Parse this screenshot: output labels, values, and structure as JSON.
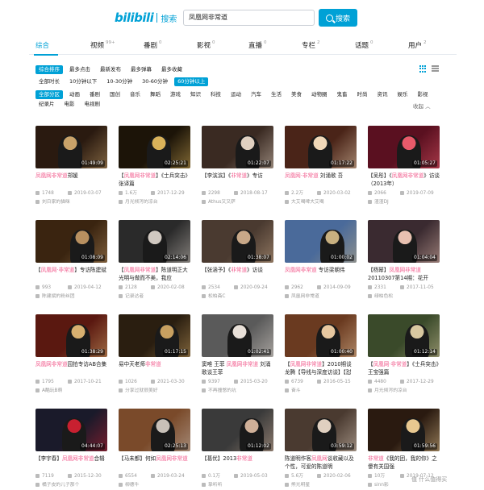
{
  "header": {
    "logo": "bilibili",
    "logo_sub": "搜索",
    "search_value": "凤凰网非常道",
    "search_button": "搜索"
  },
  "tabs": [
    {
      "label": "综合",
      "count": "",
      "active": true
    },
    {
      "label": "视频",
      "count": "99+",
      "active": false
    },
    {
      "label": "番剧",
      "count": "0",
      "active": false
    },
    {
      "label": "影视",
      "count": "0",
      "active": false
    },
    {
      "label": "直播",
      "count": "0",
      "active": false
    },
    {
      "label": "专栏",
      "count": "2",
      "active": false
    },
    {
      "label": "话题",
      "count": "0",
      "active": false
    },
    {
      "label": "用户",
      "count": "2",
      "active": false
    }
  ],
  "filters": {
    "order": [
      "综合排序",
      "最多点击",
      "最新发布",
      "最多弹幕",
      "最多收藏"
    ],
    "duration": [
      "全部时长",
      "10分钟以下",
      "10-30分钟",
      "30-60分钟",
      "60分钟以上"
    ],
    "zones_row1": [
      "全部分区",
      "动画",
      "番剧",
      "国创",
      "音乐",
      "舞蹈",
      "游戏",
      "知识",
      "科技",
      "运动",
      "汽车",
      "生活",
      "美食",
      "动物圈",
      "鬼畜",
      "时尚",
      "资讯",
      "娱乐",
      "影视"
    ],
    "zones_row2": [
      "纪录片",
      "电影",
      "电视剧"
    ],
    "collapse": "收起 ︿"
  },
  "videos": [
    {
      "title_pre": "",
      "title_hl": "凤凰网非常道",
      "title_post": "郑媛",
      "duration": "01:49:09",
      "plays": "1748",
      "date": "2019-03-07",
      "up": "刘日家的猫咪"
    },
    {
      "title_pre": "【",
      "title_hl": "凤凰网非常道",
      "title_post": "】《士兵突击》张译篇",
      "duration": "02:25:21",
      "plays": "1.6万",
      "date": "2017-12-29",
      "up": "月光倾泻的凉台"
    },
    {
      "title_pre": "【李滨滨】《",
      "title_hl": "非常道",
      "title_post": "》专访",
      "duration": "01:22:07",
      "plays": "2298",
      "date": "2018-08-17",
      "up": "Athus又又萨"
    },
    {
      "title_pre": "",
      "title_hl": "凤凰网·非常道",
      "title_post": " 刘涌歌 吾",
      "duration": "01:17:22",
      "plays": "2.2万",
      "date": "2020-03-02",
      "up": "大艾喝啤大艾喝"
    },
    {
      "title_pre": "【吴彤】《",
      "title_hl": "凤凰网非常道",
      "title_post": "》访谈（2013年）",
      "duration": "01:05:27",
      "plays": "2066",
      "date": "2019-07-09",
      "up": "渣渣DJ"
    },
    {
      "title_pre": "【",
      "title_hl": "凤凰网·非常道",
      "title_post": "】专访陈建斌",
      "duration": "01:08:09",
      "plays": "993",
      "date": "2019-04-12",
      "up": "陈建斌的粉丝团"
    },
    {
      "title_pre": "【",
      "title_hl": "凤凰网非常道",
      "title_post": "】陈道明正大光明与做而不美，我应",
      "duration": "02:14:06",
      "plays": "2128",
      "date": "2020-02-08",
      "up": "记录达者"
    },
    {
      "title_pre": "【张涵予】《",
      "title_hl": "非常道",
      "title_post": "》访谈",
      "duration": "01:38:07",
      "plays": "2534",
      "date": "2020-09-24",
      "up": "松柏斋C"
    },
    {
      "title_pre": "",
      "title_hl": "凤凰网非常道",
      "title_post": " 专访梁朝伟",
      "duration": "01:00:02",
      "plays": "2962",
      "date": "2014-09-09",
      "up": "凤凰网非常道"
    },
    {
      "title_pre": "【杨幂】",
      "title_hl": "凤凰网非常道",
      "title_post": "20110307第14期：花开",
      "duration": "01:04:04",
      "plays": "2331",
      "date": "2017-11-05",
      "up": "绿柏色松"
    },
    {
      "title_pre": "",
      "title_hl": "凤凰网非常道",
      "title_post": "园拍专访AB合集",
      "duration": "01:38:29",
      "plays": "1795",
      "date": "2017-10-21",
      "up": "A酷玩B萌"
    },
    {
      "title_pre": "易中天老师",
      "title_hl": "非常道",
      "title_post": "",
      "duration": "01:17:15",
      "plays": "1026",
      "date": "2021-03-30",
      "up": "分享过就很美好"
    },
    {
      "title_pre": "窦唯 王菲 ",
      "title_hl": "凤凰网非常道",
      "title_post": " 刘涌歌谈王菲",
      "duration": "01:02:41",
      "plays": "9397",
      "date": "2015-03-20",
      "up": "不再撞憋的坑"
    },
    {
      "title_pre": "【",
      "title_hl": "凤凰网非常道",
      "title_post": "】2010期谈龙腾【导线与深度访谈】【怼",
      "duration": "01:00:40",
      "plays": "6739",
      "date": "2016-05-15",
      "up": "奋斗"
    },
    {
      "title_pre": "【",
      "title_hl": "凤凰网·非常道",
      "title_post": "】《士兵突击》王宝强篇",
      "duration": "01:12:14",
      "plays": "4480",
      "date": "2017-12-29",
      "up": "月光倾泻的凉台"
    },
    {
      "title_pre": "【李宇春】",
      "title_hl": "凤凰网非常道",
      "title_post": "合辑",
      "duration": "04:44:07",
      "plays": "7119",
      "date": "2015-12-30",
      "up": "橘子皮的儿子那个"
    },
    {
      "title_pre": "【马未都】何如",
      "title_hl": "凤凰网非常道",
      "title_post": "",
      "duration": "02:25:13",
      "plays": "6554",
      "date": "2019-03-24",
      "up": "柳德牛"
    },
    {
      "title_pre": "【葛优】2013",
      "title_hl": "非常道",
      "title_post": "",
      "duration": "01:12:02",
      "plays": "0.1万",
      "date": "2019-05-03",
      "up": "挚听听"
    },
    {
      "title_pre": "陈道明作客",
      "title_hl": "凤凰网",
      "title_post": "谈收藏以及个性，可爱的陈道明",
      "duration": "03:59:12",
      "plays": "5.6万",
      "date": "2020-02-06",
      "up": "熊光明星"
    },
    {
      "title_pre": "",
      "title_hl": "非常道",
      "title_post": "《我的团，我的你》之傻有关国强",
      "duration": "01:59:56",
      "plays": "10万",
      "date": "2019-07-12",
      "up": "sinn影"
    }
  ],
  "colors": {
    "accent": "#00a1d6",
    "highlight": "#f25d8e",
    "meta": "#999999"
  },
  "icons": {
    "plays": "play-count-icon",
    "date": "calendar-icon",
    "up": "uploader-icon"
  },
  "watermark": "值 什么值得买"
}
